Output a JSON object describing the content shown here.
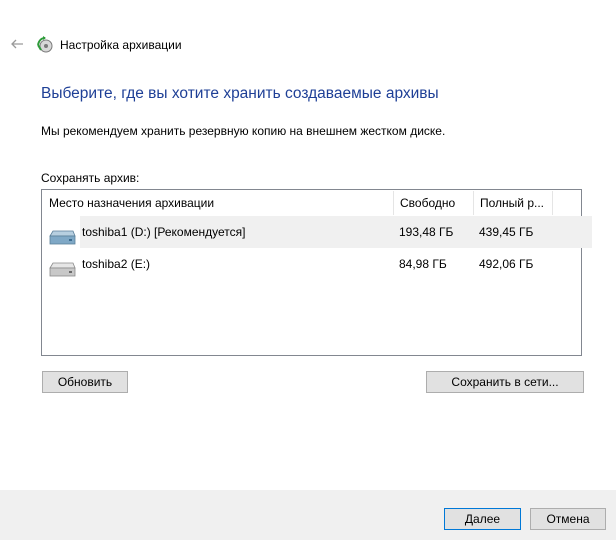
{
  "header": {
    "window_title": "Настройка архивации",
    "back_icon": "back-arrow-icon",
    "app_icon": "backup-icon"
  },
  "main": {
    "heading": "Выберите, где вы хотите хранить создаваемые архивы",
    "recommend_text": "Мы рекомендуем хранить резервную копию на внешнем жестком диске.",
    "save_label": "Сохранять архив:"
  },
  "table": {
    "columns": [
      "Место назначения архивации",
      "Свободно",
      "Полный р..."
    ],
    "rows": [
      {
        "name": "toshiba1 (D:) [Рекомендуется]",
        "free": "193,48 ГБ",
        "total": "439,45 ГБ",
        "icon": "drive-icon",
        "selected": true
      },
      {
        "name": "toshiba2 (E:)",
        "free": "84,98 ГБ",
        "total": "492,06 ГБ",
        "icon": "drive-icon",
        "selected": false
      }
    ]
  },
  "buttons": {
    "refresh": "Обновить",
    "save_network": "Сохранить в сети...",
    "next": "Далее",
    "cancel": "Отмена"
  },
  "colors": {
    "heading": "#1e3f96",
    "selected_row": "#f0f0f0",
    "footer": "#f0f0f0",
    "default_button_border": "#0078d7"
  }
}
